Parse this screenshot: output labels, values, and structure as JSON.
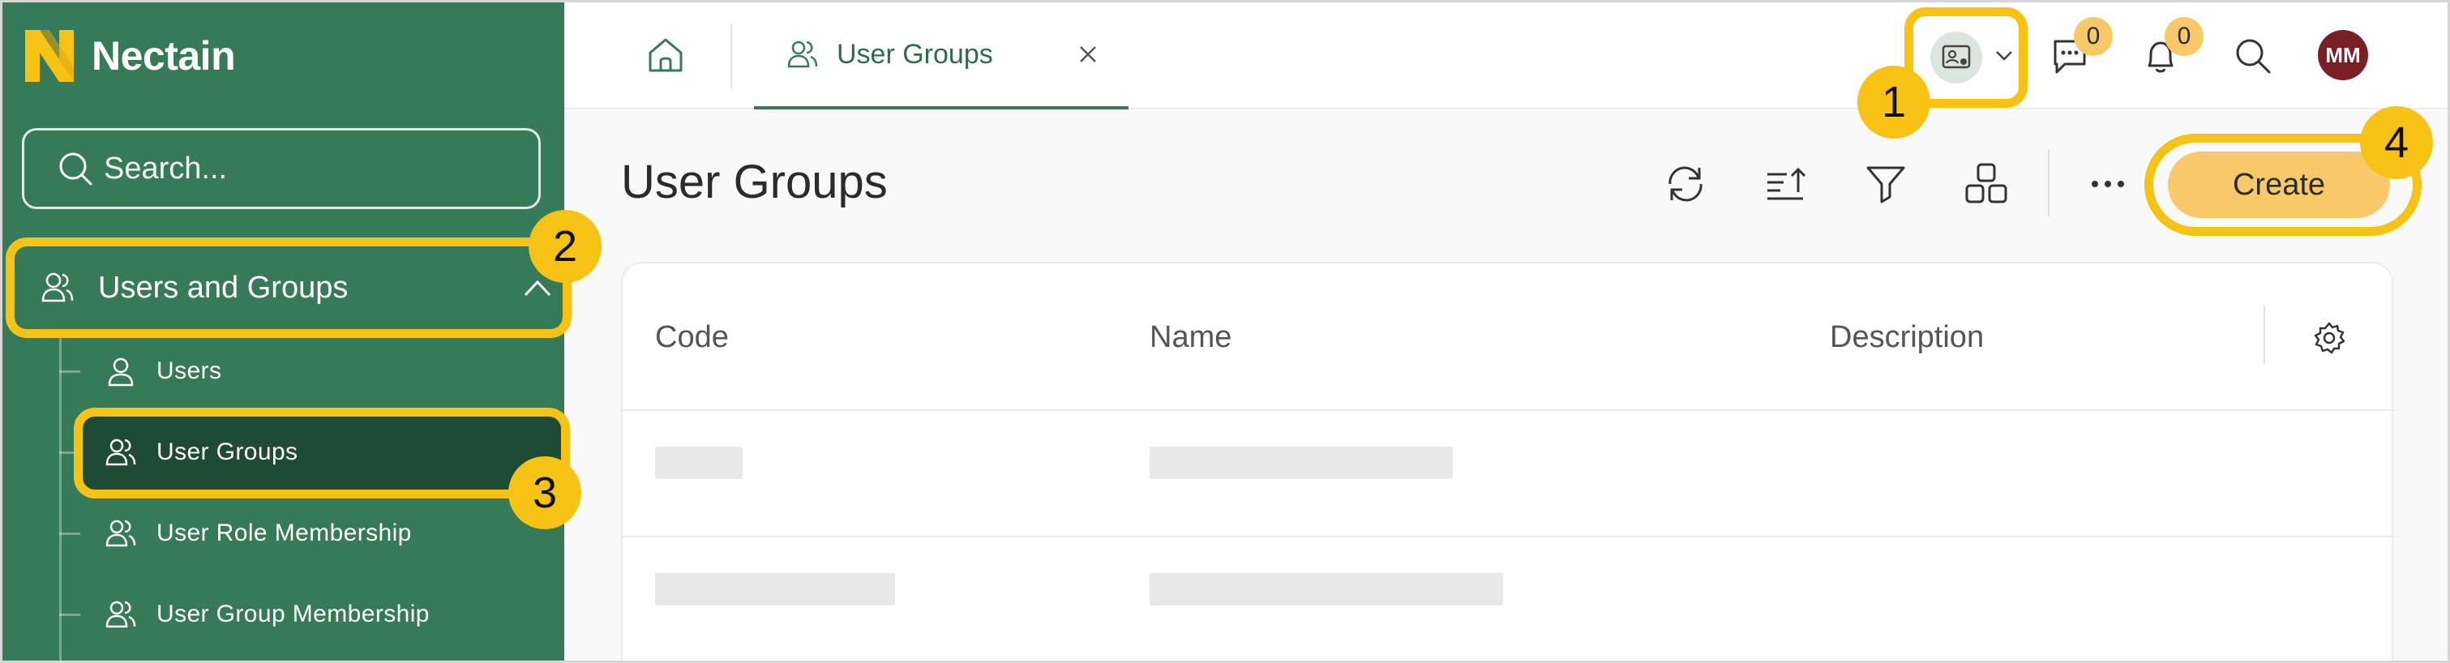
{
  "brand": {
    "name": "Nectain",
    "accent": "#377a57",
    "highlight": "#f6c315",
    "button": "#f8c968"
  },
  "sidebar": {
    "search_placeholder": "Search...",
    "group": {
      "label": "Users and Groups",
      "icon": "users-icon",
      "expanded": true
    },
    "items": [
      {
        "label": "Users",
        "icon": "user-icon",
        "active": false
      },
      {
        "label": "User Groups",
        "icon": "users-icon",
        "active": true
      },
      {
        "label": "User Role Membership",
        "icon": "users-icon",
        "active": false
      },
      {
        "label": "User Group Membership",
        "icon": "users-icon",
        "active": false
      }
    ]
  },
  "header": {
    "tab": {
      "label": "User Groups",
      "icon": "users-icon"
    },
    "messages_count": "0",
    "notifications_count": "0",
    "avatar_initials": "MM"
  },
  "main": {
    "title": "User Groups",
    "toolbar": [
      "refresh-icon",
      "sort-icon",
      "filter-icon",
      "group-icon",
      "more-icon"
    ],
    "create_label": "Create",
    "columns": [
      "Code",
      "Name",
      "Description"
    ]
  },
  "callouts": [
    "1",
    "2",
    "3",
    "4"
  ]
}
